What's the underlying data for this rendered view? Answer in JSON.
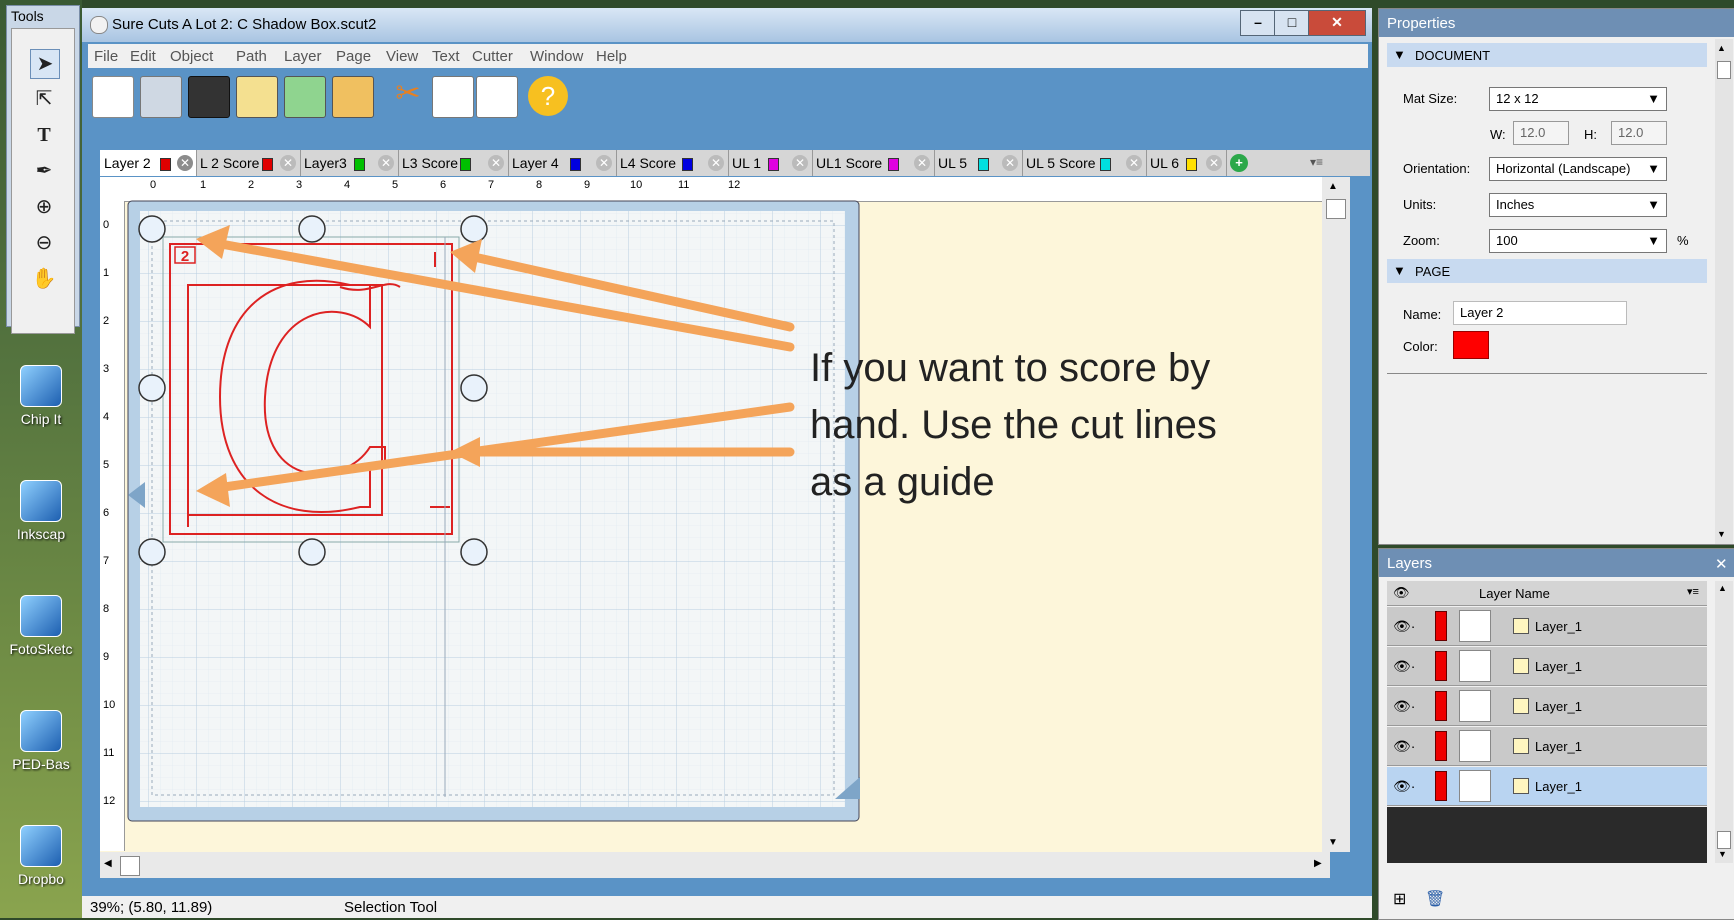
{
  "palette": {
    "title": "Tools"
  },
  "desktop": {
    "icons": [
      {
        "label": "Chip It"
      },
      {
        "label": "Inkscap"
      },
      {
        "label": "FotoSketc"
      },
      {
        "label": "PED-Bas"
      },
      {
        "label": "Dropbo"
      }
    ]
  },
  "window": {
    "title": "Sure Cuts A Lot 2: C Shadow Box.scut2",
    "menu": [
      "File",
      "Edit",
      "Object",
      "Path",
      "Layer",
      "Page",
      "View",
      "Text",
      "Cutter",
      "Window",
      "Help"
    ]
  },
  "tabs": [
    {
      "label": "Layer 2",
      "color": "#e00000"
    },
    {
      "label": "L 2 Score",
      "color": "#e00000"
    },
    {
      "label": "Layer3",
      "color": "#00c000"
    },
    {
      "label": "L3 Score",
      "color": "#00c000"
    },
    {
      "label": "Layer 4",
      "color": "#0000e0"
    },
    {
      "label": "L4 Score",
      "color": "#0000e0"
    },
    {
      "label": "UL 1",
      "color": "#e000e0"
    },
    {
      "label": "UL1 Score",
      "color": "#e000e0"
    },
    {
      "label": "UL 5",
      "color": "#00e0e0"
    },
    {
      "label": "UL 5 Score",
      "color": "#00e0e0"
    },
    {
      "label": "UL 6",
      "color": "#ffe000"
    }
  ],
  "ruler": {
    "h": [
      "0",
      "1",
      "2",
      "3",
      "4",
      "5",
      "6",
      "7",
      "8",
      "9",
      "10",
      "11",
      "12"
    ],
    "v": [
      "0",
      "1",
      "2",
      "3",
      "4",
      "5",
      "6",
      "7",
      "8",
      "9",
      "10",
      "11",
      "12"
    ]
  },
  "design": {
    "layer_number": "2"
  },
  "annotation": {
    "lines": [
      "If you want to score by",
      "hand.  Use the cut lines",
      "as a guide"
    ],
    "arrow_color": "#f4a45a"
  },
  "status": {
    "zoom_coords": "39%; (5.80, 11.89)",
    "tool": "Selection Tool"
  },
  "properties": {
    "title": "Properties",
    "document_header": "DOCUMENT",
    "mat_size_label": "Mat Size:",
    "mat_size": "12 x 12",
    "w_label": "W:",
    "w": "12.0",
    "h_label": "H:",
    "h": "12.0",
    "orientation_label": "Orientation:",
    "orientation": "Horizontal (Landscape)",
    "units_label": "Units:",
    "units": "Inches",
    "zoom_label": "Zoom:",
    "zoom": "100",
    "zoom_unit": "%",
    "page_header": "PAGE",
    "name_label": "Name:",
    "name": "Layer 2",
    "color_label": "Color:",
    "color": "#ff0000"
  },
  "layers": {
    "title": "Layers",
    "column": "Layer Name",
    "rows": [
      {
        "name": "Layer_1",
        "selected": false
      },
      {
        "name": "Layer_1",
        "selected": false
      },
      {
        "name": "Layer_1",
        "selected": false
      },
      {
        "name": "Layer_1",
        "selected": false
      },
      {
        "name": "Layer_1",
        "selected": true
      }
    ]
  }
}
